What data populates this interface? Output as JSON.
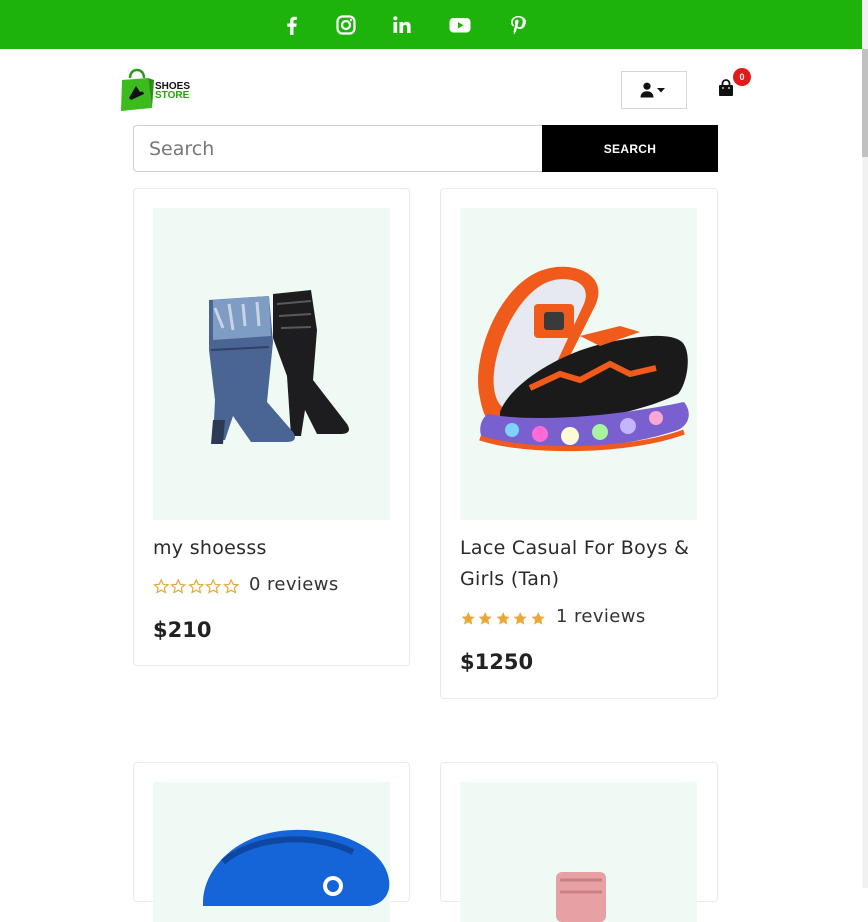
{
  "topbar": {
    "social": [
      "facebook-icon",
      "instagram-icon",
      "linkedin-icon",
      "youtube-icon",
      "pinterest-icon"
    ],
    "color": "#1db30a"
  },
  "header": {
    "logo_line1": "SHOES",
    "logo_line2": "STORE",
    "cart_count": "0"
  },
  "search": {
    "placeholder": "Search",
    "button_label": "SEARCH"
  },
  "products": [
    {
      "name": "my shoesss",
      "rating": 0,
      "reviews": "0 reviews",
      "price": "$210"
    },
    {
      "name": "Lace Casual For Boys & Girls (Tan)",
      "rating": 5,
      "reviews": "1 reviews",
      "price": "$1250"
    }
  ],
  "colors": {
    "accent": "#1db30a",
    "star": "#e9a93a",
    "badge": "#e21a1a",
    "image_bg": "#effaf4"
  }
}
